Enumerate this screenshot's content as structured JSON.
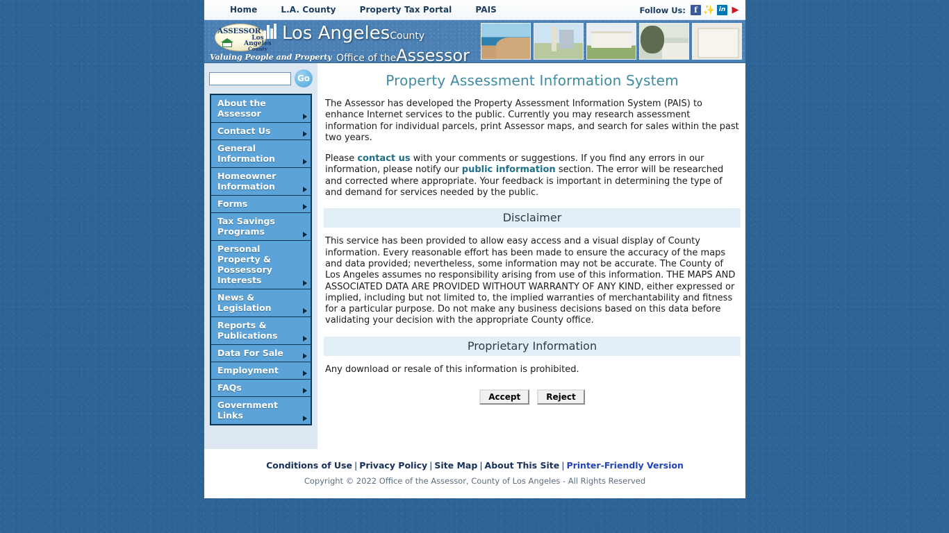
{
  "topbar": {
    "nav": [
      {
        "label": "Home",
        "name": "topnav-home"
      },
      {
        "label": "L.A. County",
        "name": "topnav-la-county"
      },
      {
        "label": "Property Tax Portal",
        "name": "topnav-property-tax-portal"
      },
      {
        "label": "PAIS",
        "name": "topnav-pais"
      }
    ],
    "follow_label": "Follow Us:",
    "social": [
      {
        "icon": "facebook-icon",
        "glyph": "f"
      },
      {
        "icon": "twitter-icon",
        "glyph": "◔"
      },
      {
        "icon": "linkedin-icon",
        "glyph": "in"
      },
      {
        "icon": "youtube-icon",
        "glyph": "▶"
      }
    ]
  },
  "banner": {
    "seal_title": "ASSESSOR",
    "seal_line1": "Los Angeles",
    "seal_line2": "County",
    "tagline": "Valuing People and Property",
    "title_line1_main": "Los Angeles",
    "title_line1_small": "County",
    "title_line2_small": "Office of the",
    "title_line2_big": "Assessor",
    "thumbnails": [
      "coastline-photo",
      "downtown-monument-photo",
      "civic-building-photo",
      "stairs-courtyard-photo",
      "historic-facade-photo"
    ]
  },
  "sidebar": {
    "search_placeholder": "",
    "search_value": "",
    "go_label": "Go",
    "items": [
      {
        "label": "About the Assessor",
        "name": "sidebar-item-about-the-assessor"
      },
      {
        "label": "Contact Us",
        "name": "sidebar-item-contact-us"
      },
      {
        "label": "General Information",
        "name": "sidebar-item-general-information"
      },
      {
        "label": "Homeowner Information",
        "name": "sidebar-item-homeowner-information"
      },
      {
        "label": "Forms",
        "name": "sidebar-item-forms"
      },
      {
        "label": "Tax Savings Programs",
        "name": "sidebar-item-tax-savings-programs"
      },
      {
        "label": "Personal Property & Possessory Interests",
        "name": "sidebar-item-personal-property-possessory-interests"
      },
      {
        "label": "News & Legislation",
        "name": "sidebar-item-news-legislation"
      },
      {
        "label": "Reports & Publications",
        "name": "sidebar-item-reports-publications"
      },
      {
        "label": "Data For Sale",
        "name": "sidebar-item-data-for-sale"
      },
      {
        "label": "Employment",
        "name": "sidebar-item-employment"
      },
      {
        "label": "FAQs",
        "name": "sidebar-item-faqs"
      },
      {
        "label": "Government Links",
        "name": "sidebar-item-government-links"
      }
    ]
  },
  "main": {
    "title": "Property Assessment Information System",
    "intro_paragraph": "The Assessor has developed the Property Assessment Information System (PAIS) to enhance Internet services to the public. Currently you may research assessment information for individual parcels, print Assessor maps, and search for sales within the past two years.",
    "feedback": {
      "before_link1": "Please ",
      "link1": "contact us",
      "between_links": " with your comments or suggestions. If you find any errors in our information, please notify our ",
      "link2": "public information",
      "after_link2": " section. The error will be researched and corrected where appropriate. Your feedback is important in determining the type of and demand for services needed by the public."
    },
    "disclaimer_heading": "Disclaimer",
    "disclaimer_text": "This service has been provided to allow easy access and a visual display of County information. Every reasonable effort has been made to ensure the accuracy of the maps and data provided; nevertheless, some information may not be accurate. The County of Los Angeles assumes no responsibility arising from use of this information. THE MAPS AND ASSOCIATED DATA ARE PROVIDED WITHOUT WARRANTY OF ANY KIND, either expressed or implied, including but not limited to, the implied warranties of merchantability and fitness for a particular purpose. Do not make any business decisions based on this data before validating your decision with the appropriate County office.",
    "proprietary_heading": "Proprietary Information",
    "proprietary_text": "Any download or resale of this information is prohibited.",
    "accept_label": "Accept",
    "reject_label": "Reject"
  },
  "footer": {
    "links": [
      {
        "label": "Conditions of Use",
        "name": "footer-link-conditions-of-use",
        "highlight": false
      },
      {
        "label": "Privacy Policy",
        "name": "footer-link-privacy-policy",
        "highlight": false
      },
      {
        "label": "Site Map",
        "name": "footer-link-site-map",
        "highlight": false
      },
      {
        "label": "About This Site",
        "name": "footer-link-about-this-site",
        "highlight": false
      },
      {
        "label": "Printer-Friendly Version",
        "name": "footer-link-printer-friendly-version",
        "highlight": true
      }
    ],
    "separator": "|",
    "copyright": "Copyright © 2022 Office of the Assessor, County of Los Angeles - All Rights Reserved"
  },
  "colors": {
    "page_background": "#2c6496",
    "menu_blue": "#5ba3d9",
    "sidebar_background": "#dce7f2",
    "title_teal": "#3f8ba0",
    "section_band": "#e3eff7",
    "link_teal": "#1f6f86"
  }
}
